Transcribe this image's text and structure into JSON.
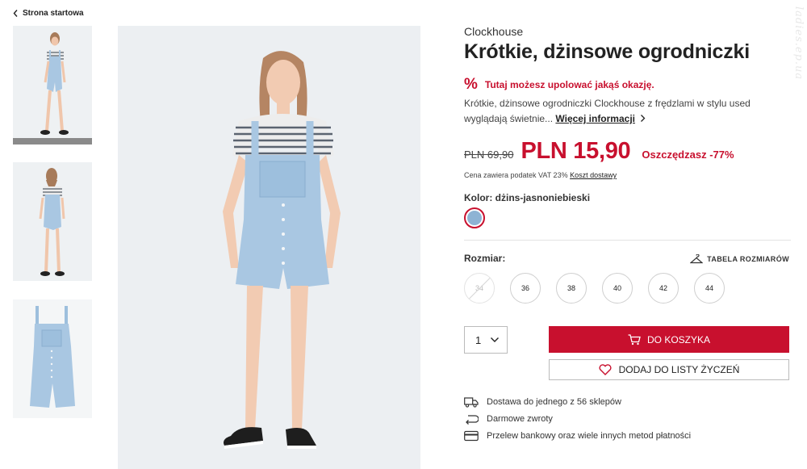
{
  "nav": {
    "back_label": "Strona startowa"
  },
  "product": {
    "brand": "Clockhouse",
    "title": "Krótkie, dżinsowe ogrodniczki",
    "deal_icon": "%",
    "deal_text": "Tutaj możesz upolować jakąś okazję.",
    "description": "Krótkie, dżinsowe ogrodniczki Clockhouse z frędzlami w stylu used wyglądają świetnie...",
    "more_label": "Więcej informacji",
    "old_price": "PLN 69,90",
    "price": "PLN 15,90",
    "savings": "Oszczędzasz -77%",
    "vat_text": "Cena zawiera podatek VAT 23%",
    "shipping_link": "Koszt dostawy",
    "color_label": "Kolor: dżins-jasnoniebieski",
    "swatch_color": "#8eb3d4",
    "accent_color": "#c8102e"
  },
  "sizes": {
    "label": "Rozmiar:",
    "table_label": "TABELA ROZMIARÓW",
    "options": [
      {
        "value": "34",
        "available": false
      },
      {
        "value": "36",
        "available": true
      },
      {
        "value": "38",
        "available": true
      },
      {
        "value": "40",
        "available": true
      },
      {
        "value": "42",
        "available": true
      },
      {
        "value": "44",
        "available": true
      }
    ]
  },
  "purchase": {
    "quantity": "1",
    "cart_label": "DO KOSZYKA",
    "wishlist_label": "DODAJ DO LISTY ŻYCZEŃ"
  },
  "benefits": [
    {
      "icon": "truck-icon",
      "text": "Dostawa do jednego z 56 sklepów"
    },
    {
      "icon": "return-arrow-icon",
      "text": "Darmowe zwroty"
    },
    {
      "icon": "credit-card-icon",
      "text": "Przelew bankowy oraz wiele innych metod płatności"
    }
  ],
  "watermark": "ladies.ep.ua",
  "gallery": {
    "thumbnail_count": 3
  }
}
